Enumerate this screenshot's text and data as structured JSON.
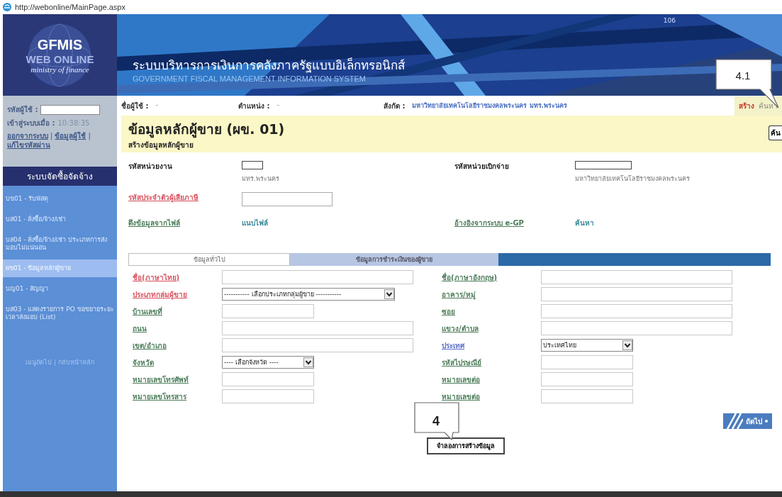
{
  "browser": {
    "address": "http://webonline/MainPage.aspx"
  },
  "header": {
    "logo": {
      "title": "GFMIS",
      "subtitle": "WEB ONLINE",
      "tagline": "ministry of finance"
    },
    "title_th": "ระบบบริหารการเงินการคลังภาครัฐแบบอิเล็กทรอนิกส์",
    "title_en": "GOVERNMENT FISCAL MANAGEMENT INFORMATION SYSTEM",
    "counter": "106"
  },
  "sidebar": {
    "user_label": "รหัสผู้ใช้ :",
    "login_label": "เข้าสู่ระบบเมื่อ :",
    "login_time": "10:38:35",
    "separator": "|",
    "links": [
      "ออกจากระบบ",
      "ข้อมูลผู้ใช้",
      "แก้ไขรหัสผ่าน"
    ],
    "menu_title": "ระบบจัดซื้อจัดจ้าง",
    "menu": [
      {
        "label": "บข01 - รับพัสดุ",
        "selected": false
      },
      {
        "label": "บส01 - สั่งซื้อ/จ้าง/เช่า",
        "selected": false
      },
      {
        "label": "บส04 - สั่งซื้อ/จ้าง/เช่า ประเภทการส่งมอบไม่แน่นอน",
        "selected": false
      },
      {
        "label": "ผข01 - ข้อมูลหลักผู้ขาย",
        "selected": true
      },
      {
        "label": "บญ01 - สัญญา",
        "selected": false
      },
      {
        "label": "บส03 - แสดงรายการ PO ขอขยายระยะเวลาส่งมอบ (List)",
        "selected": false
      }
    ],
    "footer": "เมนูถัดไป | กลับหน้าหลัก"
  },
  "user_bar": {
    "fields": [
      {
        "label": "ชื่อผู้ใช้ :",
        "value": "-"
      },
      {
        "label": "ตำแหน่ง :",
        "value": "-"
      },
      {
        "label": "สังกัด :",
        "value": "มหาวิทยาลัยเทคโนโลยีราชมงคลพระนคร มทร.พระนคร"
      }
    ],
    "actions": [
      {
        "label": "สร้าง",
        "selected": true
      },
      {
        "label": "ค้นหา",
        "selected": false
      }
    ]
  },
  "page": {
    "title": "ข้อมูลหลักผู้ขาย (ผข. 01)",
    "subtitle": "สร้างข้อมูลหลักผู้ขาย",
    "side_button": "ค้น"
  },
  "top_form": {
    "unit": {
      "label": "รหัสหน่วยงาน",
      "description": "มทร.พระนคร"
    },
    "disbursing": {
      "label": "รหัสหน่วยเบิกจ่าย",
      "description": "มหาวิทยาลัยเทคโนโลยีราชมงคลพระนคร"
    },
    "tax_id": {
      "label": "รหัสประจำตัวผู้เสียภาษี"
    },
    "file_link": "ดึงข้อมูลจากไฟล์",
    "attach_link": "แนบไฟล์",
    "egp_link": "อ้างอิงจากระบบ e-GP",
    "search_link": "ค้นหา"
  },
  "tabs": [
    {
      "label": "ข้อมูลทั่วไป",
      "selected": true
    },
    {
      "label": "ข้อมูลการชำระเงินของผู้ขาย",
      "selected": false
    }
  ],
  "rows": [
    {
      "left": {
        "label": "ชื่อ(ภาษาไทย)",
        "required": true,
        "highlighted": false,
        "kind": "input",
        "wide": true
      },
      "right": {
        "label": "ชื่อ(ภาษาอังกฤษ)",
        "required": false,
        "highlighted": false,
        "kind": "input",
        "wide": true
      }
    },
    {
      "left": {
        "label": "ประเภทกลุ่มผู้ขาย",
        "required": true,
        "highlighted": false,
        "kind": "select",
        "wide": true,
        "value": "----------- เลือกประเภทกลุ่มผู้ขาย -----------"
      },
      "right": {
        "label": "อาคาร/หมู่",
        "required": false,
        "highlighted": false,
        "kind": "input",
        "wide": true
      }
    },
    {
      "left": {
        "label": "บ้านเลขที่",
        "required": false,
        "highlighted": false,
        "kind": "input",
        "wide": false
      },
      "right": {
        "label": "ซอย",
        "required": false,
        "highlighted": false,
        "kind": "input",
        "wide": true
      }
    },
    {
      "left": {
        "label": "ถนน",
        "required": false,
        "highlighted": false,
        "kind": "input",
        "wide": true
      },
      "right": {
        "label": "แขวง/ตำบล",
        "required": false,
        "highlighted": false,
        "kind": "input",
        "wide": true
      }
    },
    {
      "left": {
        "label": "เขต/อำเภอ",
        "required": false,
        "highlighted": false,
        "kind": "input",
        "wide": true
      },
      "right": {
        "label": "ประเทศ",
        "required": false,
        "highlighted": true,
        "kind": "select",
        "wide": false,
        "value": "ประเทศไทย"
      }
    },
    {
      "left": {
        "label": "จังหวัด",
        "required": false,
        "highlighted": false,
        "kind": "select",
        "wide": false,
        "value": "---- เลือกจังหวัด ----"
      },
      "right": {
        "label": "รหัสไปรษณีย์",
        "required": false,
        "highlighted": false,
        "kind": "input",
        "wide": false
      }
    },
    {
      "left": {
        "label": "หมายเลขโทรศัพท์",
        "required": false,
        "highlighted": false,
        "kind": "input",
        "wide": false
      },
      "right": {
        "label": "หมายเลขต่อ",
        "required": false,
        "highlighted": false,
        "kind": "input",
        "wide": false
      }
    },
    {
      "left": {
        "label": "หมายเลขโทรสาร",
        "required": false,
        "highlighted": false,
        "kind": "input",
        "wide": false
      },
      "right": {
        "label": "หมายเลขต่อ",
        "required": false,
        "highlighted": false,
        "kind": "input",
        "wide": false
      }
    }
  ],
  "buttons": {
    "save": "จำลองการสร้างข้อมูล",
    "next": "ถัดไป"
  },
  "callouts": [
    {
      "label": "4.1",
      "kind": "top"
    },
    {
      "label": "4",
      "kind": "bottom"
    }
  ]
}
